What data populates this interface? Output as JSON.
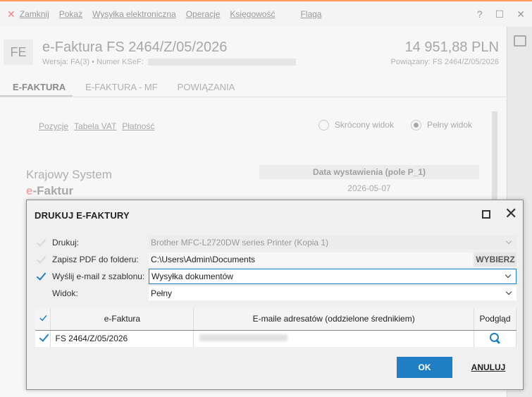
{
  "app": {
    "menu": [
      "Zamknij",
      "Pokaż",
      "Wysyłka elektroniczna",
      "Operacje",
      "Księgowość",
      "Flaga"
    ],
    "help": "?",
    "doc_badge": "FE",
    "doc_title": "e-Faktura FS 2464/Z/05/2026",
    "doc_subtitle": "Wersja: FA(3) • Numer KSeF:",
    "amount": "14 951,88 PLN",
    "related": "Powiązany: FS 2464/Z/05/2026",
    "tabs": [
      "E-FAKTURA",
      "E-FAKTURA - MF",
      "POWIĄZANIA"
    ],
    "subtabs": [
      "Pozycje",
      "Tabela VAT",
      "Płatność"
    ],
    "view_short": "Skrócony widok",
    "view_full": "Pełny widok",
    "ksef_line1": "Krajowy System",
    "ksef_e": "e",
    "ksef_rest": "-Faktur",
    "date_header": "Data wystawienia (pole P_1)",
    "date_value": "2026-05-07"
  },
  "dialog": {
    "title": "DRUKUJ E-FAKTURY",
    "print_label": "Drukuj:",
    "printer": "Brother MFC-L2720DW series Printer (Kopia 1)",
    "pdf_label": "Zapisz PDF do folderu:",
    "pdf_path": "C:\\Users\\Admin\\Documents",
    "choose_label": "WYBIERZ",
    "email_label": "Wyślij e-mail z szablonu:",
    "email_template": "Wysyłka dokumentów",
    "view_label": "Widok:",
    "view_value": "Pełny",
    "columns": [
      "e-Faktura",
      "E-maile adresatów (oddzielone średnikiem)",
      "Podgląd"
    ],
    "rows": [
      {
        "invoice": "FS 2464/Z/05/2026"
      }
    ],
    "ok_label": "OK",
    "cancel_label": "ANULUJ"
  },
  "colors": {
    "accent": "#1f7ec4",
    "top_border": "#ff9a5a"
  }
}
